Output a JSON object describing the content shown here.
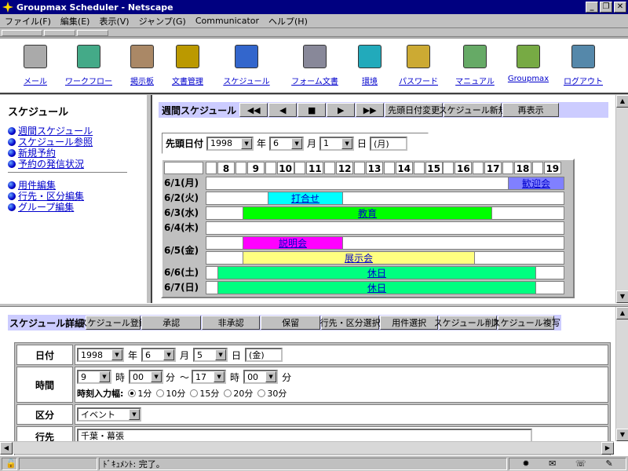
{
  "window": {
    "title": "Groupmax Scheduler - Netscape",
    "btn_min": "_",
    "btn_max": "❐",
    "btn_close": "✕"
  },
  "menu": [
    "ファイル(F)",
    "編集(E)",
    "表示(V)",
    "ジャンプ(G)",
    "Communicator",
    "ヘルプ(H)"
  ],
  "apps": [
    "メール",
    "ワークフロー",
    "掲示板",
    "文書管理",
    "スケジュール",
    "フォーム文書",
    "環境",
    "パスワード",
    "マニュアル",
    "Groupmax",
    "ログアウト"
  ],
  "left": {
    "title": "スケジュール",
    "links1": [
      "週間スケジュール",
      "スケジュール参照",
      "新規予約",
      "予約の発信状況"
    ],
    "links2": [
      "用件編集",
      "行先・区分編集",
      "グループ編集"
    ]
  },
  "weekly": {
    "label": "週間スケジュール",
    "nav": [
      "◀◀",
      "◀",
      "■",
      "▶",
      "▶▶"
    ],
    "buttons": [
      "先頭日付変更",
      "スケジュール新規",
      "再表示"
    ],
    "start_label": "先頭日付",
    "year": "1998",
    "year_unit": "年",
    "month": "6",
    "month_unit": "月",
    "day": "1",
    "day_unit": "日",
    "weekday": "(月)",
    "hours": [
      "8",
      "9",
      "10",
      "11",
      "12",
      "13",
      "14",
      "15",
      "16",
      "17",
      "18",
      "19"
    ],
    "days": [
      "6/1(月)",
      "6/2(火)",
      "6/3(水)",
      "6/4(木)",
      "6/5(金)",
      "6/6(土)",
      "6/7(日)"
    ],
    "events": [
      {
        "day": 0,
        "title": "歓迎会",
        "color": "#8080ff"
      },
      {
        "day": 1,
        "title": "打合せ",
        "color": "#00ffff"
      },
      {
        "day": 2,
        "title": "教育",
        "color": "#00ff00"
      },
      {
        "day": 4,
        "title": "説明会",
        "color": "#ff00ff"
      },
      {
        "day": 4,
        "title": "展示会",
        "color": "#ffff80"
      },
      {
        "day": 5,
        "title": "休日",
        "color": "#00ff80"
      },
      {
        "day": 6,
        "title": "休日",
        "color": "#00ff80"
      }
    ]
  },
  "detail": {
    "label": "スケジュール詳細",
    "buttons": [
      "スケジュール登録",
      "承認",
      "非承認",
      "保留",
      "行先・区分選択",
      "用件選択",
      "スケジュール削除",
      "スケジュール複写"
    ],
    "date_label": "日付",
    "year": "1998",
    "year_unit": "年",
    "month": "6",
    "month_unit": "月",
    "day": "5",
    "day_unit": "日",
    "weekday": "(金)",
    "time_label": "時間",
    "start_hour": "9",
    "start_min": "00",
    "end_hour": "17",
    "end_min": "00",
    "hour_unit": "時",
    "min_unit": "分",
    "tilde": "～",
    "step_label": "時刻入力幅:",
    "steps": [
      "1分",
      "10分",
      "15分",
      "20分",
      "30分"
    ],
    "category_label": "区分",
    "category": "イベント",
    "dest_label": "行先",
    "dest_value": "千葉・幕張"
  },
  "status": {
    "text": "ﾄﾞｷｭﾒﾝﾄ: 完了。"
  }
}
